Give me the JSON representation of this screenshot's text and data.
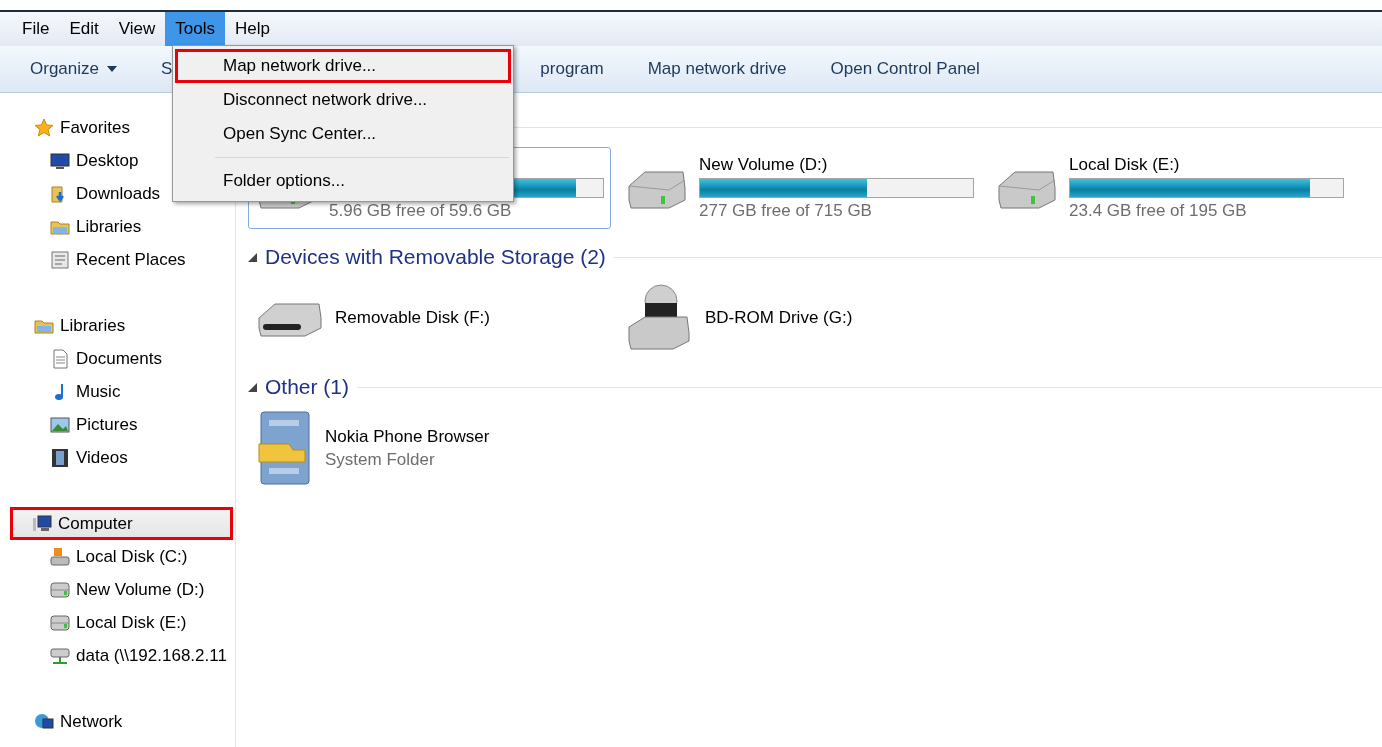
{
  "menu_bar": [
    {
      "label": "File",
      "selected": false
    },
    {
      "label": "Edit",
      "selected": false
    },
    {
      "label": "View",
      "selected": false
    },
    {
      "label": "Tools",
      "selected": true
    },
    {
      "label": "Help",
      "selected": false
    }
  ],
  "toolbar": [
    {
      "label": "Organize",
      "kind": "dropdown"
    },
    {
      "label": "S",
      "kind": "plain"
    },
    {
      "label": "program",
      "kind": "plain"
    },
    {
      "label": "Map network drive",
      "kind": "plain"
    },
    {
      "label": "Open Control Panel",
      "kind": "plain"
    }
  ],
  "tools_menu": {
    "items": [
      {
        "label": "Map network drive...",
        "highlighted": true,
        "kind": "item"
      },
      {
        "label": "Disconnect network drive...",
        "highlighted": false,
        "kind": "item"
      },
      {
        "label": "Open Sync Center...",
        "highlighted": false,
        "kind": "item"
      },
      {
        "kind": "separator"
      },
      {
        "label": "Folder options...",
        "highlighted": false,
        "kind": "item"
      }
    ]
  },
  "sidebar": {
    "items": [
      {
        "label": "Favorites",
        "highlighted": false,
        "children": [
          {
            "label": "Desktop"
          },
          {
            "label": "Downloads"
          },
          {
            "label": "Libraries"
          },
          {
            "label": "Recent Places"
          }
        ]
      },
      {
        "label": "Libraries",
        "highlighted": false,
        "children": [
          {
            "label": "Documents"
          },
          {
            "label": "Music"
          },
          {
            "label": "Pictures"
          },
          {
            "label": "Videos"
          }
        ]
      },
      {
        "label": "Computer",
        "highlighted": true,
        "children": [
          {
            "label": "Local Disk (C:)"
          },
          {
            "label": "New Volume (D:)"
          },
          {
            "label": "Local Disk (E:)"
          },
          {
            "label": "data (\\\\192.168.2.11"
          }
        ]
      },
      {
        "label": "Network",
        "highlighted": false
      }
    ]
  },
  "groups": [
    {
      "items": [
        {
          "kind": "disk",
          "selected": true,
          "level": 0.9,
          "free": "5.96 GB free of 59.6 GB"
        },
        {
          "kind": "disk",
          "selected": false,
          "name": "New Volume (D:)",
          "level": 0.61,
          "free": "277 GB free of 715 GB"
        },
        {
          "kind": "disk",
          "selected": false,
          "name": "Local Disk (E:)",
          "level": 0.88,
          "free": "23.4 GB free of 195 GB"
        }
      ]
    },
    {
      "title": "Devices with Removable Storage (2)",
      "items": [
        {
          "kind": "removable",
          "selected": false,
          "name": "Removable Disk (F:)"
        },
        {
          "kind": "optical",
          "selected": false,
          "name": "BD-ROM Drive (G:)"
        }
      ]
    },
    {
      "title": "Other (1)",
      "items": [
        {
          "kind": "folder",
          "selected": false,
          "name": "Nokia Phone Browser",
          "subtitle": "System Folder"
        }
      ]
    }
  ]
}
